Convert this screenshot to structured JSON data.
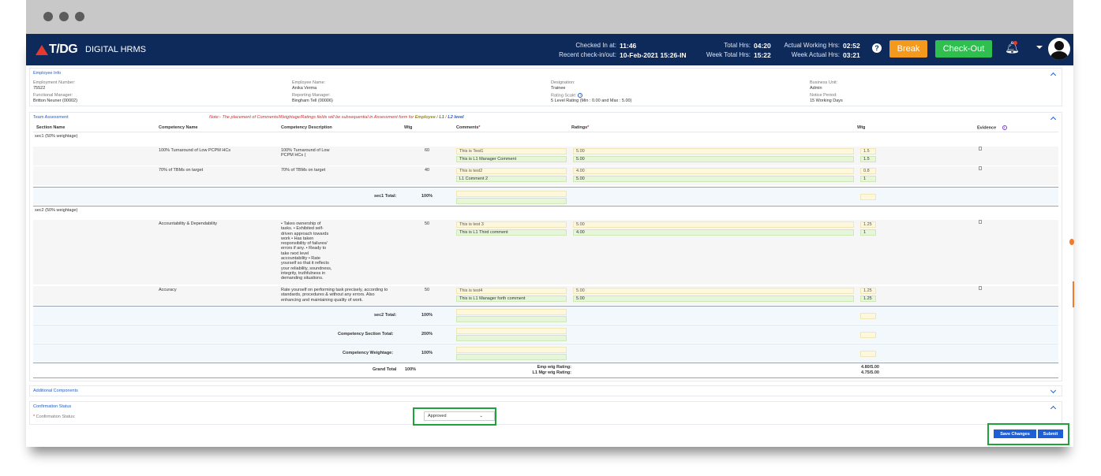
{
  "header": {
    "logo": "T/DG",
    "app_name": "DIGITAL HRMS",
    "checked_in_label": "Checked In at:",
    "checked_in_value": "11:46",
    "recent_label": "Recent check-in/out:",
    "recent_value": "10-Feb-2021 15:26-IN",
    "total_hrs_label": "Total Hrs:",
    "total_hrs_value": "04:20",
    "week_total_label": "Week Total Hrs:",
    "week_total_value": "15:22",
    "actual_working_label": "Actual Working Hrs:",
    "actual_working_value": "02:52",
    "week_actual_label": "Week Actual Hrs:",
    "week_actual_value": "03:21",
    "help": "?",
    "break_label": "Break",
    "checkout_label": "Check-Out"
  },
  "employee_info": {
    "title": "Employee Info",
    "fields": [
      {
        "label": "Employment Number:",
        "value": "75522"
      },
      {
        "label": "Employee Name:",
        "value": "Anika Verma"
      },
      {
        "label": "Designation:",
        "value": "Trainee"
      },
      {
        "label": "Business Unit:",
        "value": "Admin"
      },
      {
        "label": "Functional Manager:",
        "value": "Britton Neuner (00002)"
      },
      {
        "label": "Reporting Manager:",
        "value": "Bingham Tell (00006)"
      },
      {
        "label": "Rating Scale:",
        "value": "5 Level Rating (Min : 0.00 and Max : 5.00)"
      },
      {
        "label": "Notice Period:",
        "value": "15 Working Days"
      }
    ]
  },
  "team_assessment": {
    "title": "Team Assessment",
    "note_prefix": "Note:- The placement of Comments/Weightage/Ratings fields will be subsequential in Assessment form for",
    "note_employee": "Employee",
    "note_l1": "L1",
    "note_l2": "L2 level",
    "columns": [
      "Section Name",
      "Competency Name",
      "Competency Description",
      "Wtg",
      "Comments",
      "Ratings",
      "Wtg",
      "Evidence"
    ],
    "sec1_name": "sec1 (50% weightage)",
    "sec1_rows": [
      {
        "name": "100% Turnaround of Low PCPM HCs",
        "desc_1": "100% Turnaround of Low",
        "desc_2": "PCPM HCs (",
        "wtg": "60",
        "comment_emp": "This is Test1",
        "comment_l1": "This is L1 Manager Comment",
        "rating_emp": "5.00",
        "rating_l1": "5.00",
        "wtg_emp": "1.5",
        "wtg_l1": "1.5"
      },
      {
        "name": "70% of TBMs on target",
        "desc_1": "70% of TBMs on target",
        "desc_2": "",
        "wtg": "40",
        "comment_emp": "This is test2",
        "comment_l1": "L1 Comment 2",
        "rating_emp": "4.00",
        "rating_l1": "5.00",
        "wtg_emp": "0.8",
        "wtg_l1": "1"
      }
    ],
    "sec1_total_label": "sec1 Total:",
    "sec1_total_value": "100%",
    "sec2_name": "sec2 (50% weightage)",
    "sec2_rows": [
      {
        "name": "Accountability & Dependability",
        "desc_lines": [
          "• Takes ownership of",
          "tasks. • Exhibited self-",
          "driven approach towards",
          "work • Has taken",
          "responsibility of failures/",
          "errors if any. • Ready to",
          "take next level",
          "accountability • Rate",
          "yourself so that it reflects",
          "your reliability, soundness,",
          "integrity, truthfulness in",
          "demanding situations."
        ],
        "wtg": "50",
        "comment_emp": "This is test 3",
        "comment_l1": "This is L1 Third comment",
        "rating_emp": "5.00",
        "rating_l1": "4.00",
        "wtg_emp": "1.25",
        "wtg_l1": "1"
      },
      {
        "name": "Accuracy",
        "desc_lines": [
          "Rate yourself on performing task precisely, according to",
          "standards, procedures & without any errors. Also",
          "enhancing and maintaining quality of work."
        ],
        "wtg": "50",
        "comment_emp": "This is test4",
        "comment_l1": "This is L1 Manager forth comment",
        "rating_emp": "5.00",
        "rating_l1": "5.00",
        "wtg_emp": "1.25",
        "wtg_l1": "1.25"
      }
    ],
    "sec2_total_label": "sec2 Total:",
    "sec2_total_value": "100%",
    "comp_total_label": "Competency Section Total:",
    "comp_total_value": "200%",
    "comp_weightage_label": "Competency Weightage:",
    "comp_weightage_value": "100%",
    "grand_total_label": "Grand Total",
    "grand_total_value": "100%",
    "emp_wtg_label": "Emp wtg Rating:",
    "emp_wtg_value": "4.80/5.00",
    "l1_wtg_label": "L1 Mgr wtg Rating:",
    "l1_wtg_value": "4.75/5.00"
  },
  "additional": {
    "title": "Additional Components"
  },
  "confirmation": {
    "title": "Confirmation Status",
    "label": "Confirmation Status:",
    "value": "Approved"
  },
  "actions": {
    "save": "Save Changes",
    "submit": "Submit"
  },
  "colors": {
    "header_bg": "#0e2a5a",
    "break": "#f39a1e",
    "checkout": "#2fbf4e",
    "link": "#1e5fc9",
    "highlight": "#1ea33b"
  }
}
